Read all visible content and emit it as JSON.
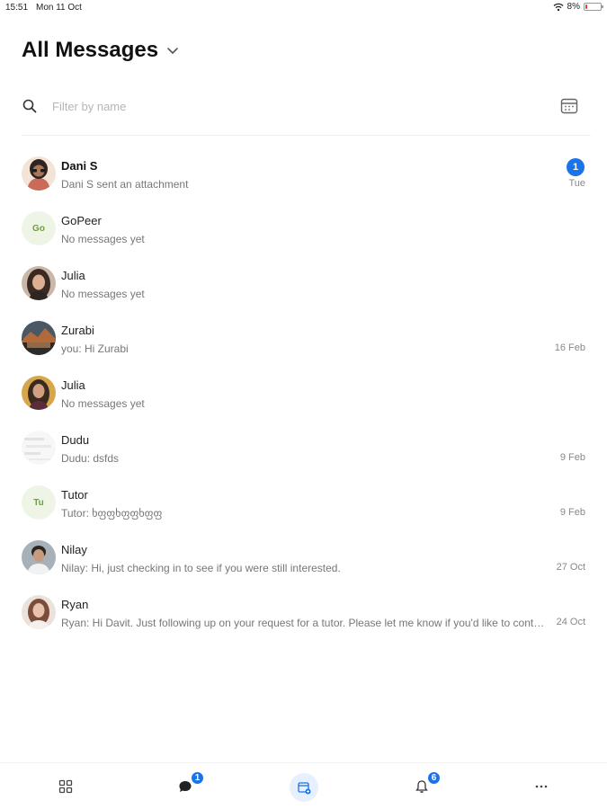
{
  "status_bar": {
    "time": "15:51",
    "date": "Mon 11 Oct",
    "battery": "8%"
  },
  "header": {
    "title": "All Messages"
  },
  "search": {
    "placeholder": "Filter by name"
  },
  "conversations": [
    {
      "name": "Dani S",
      "preview": "Dani S sent an attachment",
      "date": "Tue",
      "unread": "1",
      "avatar": "photo"
    },
    {
      "name": "GoPeer",
      "preview": "No messages yet",
      "date": "",
      "initials": "Go"
    },
    {
      "name": "Julia",
      "preview": "No messages yet",
      "date": "",
      "avatar": "photo"
    },
    {
      "name": "Zurabi",
      "preview": "you: Hi Zurabi",
      "date": "16 Feb",
      "avatar": "photo"
    },
    {
      "name": "Julia",
      "preview": "No messages yet",
      "date": "",
      "avatar": "photo"
    },
    {
      "name": "Dudu",
      "preview": "Dudu: dsfds",
      "date": "9 Feb",
      "avatar": "photo"
    },
    {
      "name": "Tutor",
      "preview": "Tutor: ხფფხფფხფფ",
      "date": "9 Feb",
      "initials": "Tu"
    },
    {
      "name": "Nilay",
      "preview": "Nilay: Hi, just checking in to see if you were still interested.",
      "date": "27 Oct",
      "avatar": "photo"
    },
    {
      "name": "Ryan",
      "preview": "Ryan: Hi Davit. Just following up on your request for a tutor. Please let me know if you'd like to continue.",
      "date": "24 Oct",
      "avatar": "photo"
    }
  ],
  "bottom_nav": {
    "messages_badge": "1",
    "notifications_badge": "6"
  },
  "colors": {
    "accent": "#1a73e8",
    "initials_bg": "#eef5e6",
    "initials_fg": "#6ba03a"
  }
}
